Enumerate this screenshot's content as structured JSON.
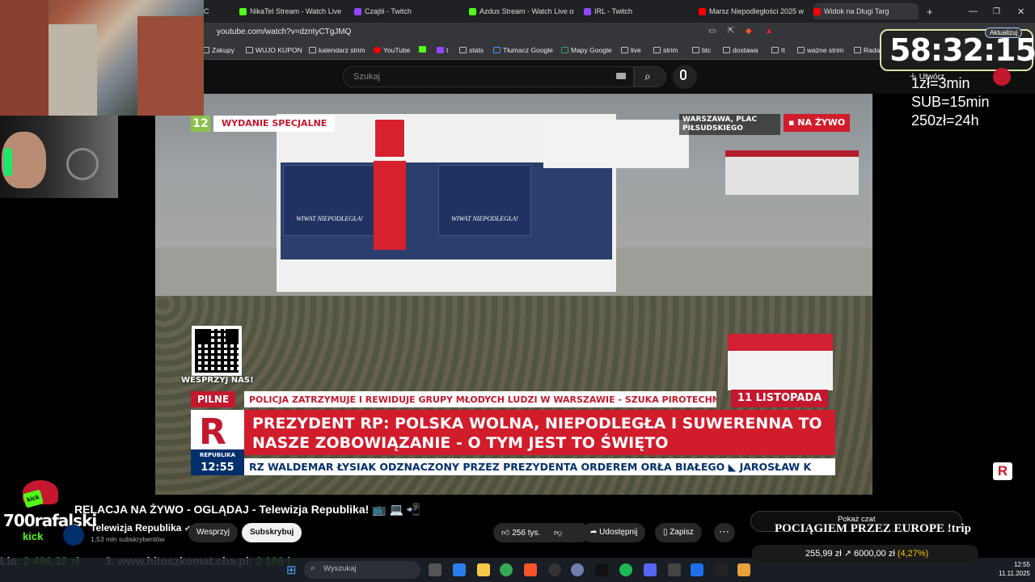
{
  "browser": {
    "tabs": [
      {
        "label": "C",
        "color": "#888888"
      },
      {
        "label": "NikaTel Stream - Watch Live",
        "color": "#53fc18"
      },
      {
        "label": "Czajtii - Twitch",
        "color": "#9146ff"
      },
      {
        "label": "Azdus Stream - Watch Live on",
        "color": "#53fc18"
      },
      {
        "label": "IRL - Twitch",
        "color": "#9146ff"
      },
      {
        "label": "Marsz Niepodległości 2025 w",
        "color": "#ff0000"
      },
      {
        "label": "Widok na Długi Targ",
        "color": "#ff0000"
      }
    ],
    "new_tab": "+",
    "url": "youtube.com/watch?v=dzntyCTgJMQ",
    "update_label": "Aktualizuj",
    "bookmarks": [
      "Zakupy",
      "WUJO KUPON",
      "kalendarz strim",
      "YouTube",
      "t",
      "stats",
      "Tłumacz Google",
      "Mapy Google",
      "live",
      "strim",
      "btc",
      "dostawa",
      "tt",
      "ważne strim",
      "Rada"
    ]
  },
  "youtube": {
    "search_placeholder": "Szukaj",
    "create_label": "Utwórz",
    "video_title": "RELACJA NA ŻYWO - OGLĄDAJ - Telewizja Republika! 📺 💻 📲",
    "channel_name": "Telewizja Republika",
    "subscribers": "1,53 mln subskrybentów",
    "support_label": "Wesprzyj",
    "subscribe_label": "Subskrybuj",
    "likes": "256 tys.",
    "share_label": "Udostępnij",
    "save_label": "Zapisz",
    "more_label": "⋯",
    "show_chat_label": "Pokaż czat"
  },
  "broadcast": {
    "channel_number": "12",
    "special_edition": "WYDANIE SPECJALNE",
    "location": "WARSZAWA, PLAC PIŁSUDSKIEGO",
    "live_label": "▪ NA ŻYWO",
    "banner_text": "WIWAT NIEPODLEGŁA!",
    "qr_caption": "WESPRZYJ NAS!",
    "date_label": "11 LISTOPADA",
    "urgent_label": "PILNE",
    "urgent_text": "POLICJA ZATRZYMUJE I REWIDUJE GRUPY MŁODYCH LUDZI W WARSZAWIE - SZUKA PIROTECHNIKI",
    "headline": "PREZYDENT RP: POLSKA WOLNA, NIEPODLEGŁA I SUWERENNA TO NASZE ZOBOWIĄZANIE - O TYM JEST TO ŚWIĘTO",
    "logo_letter": "R",
    "logo_name": "REPUBLIKA",
    "time": "12:55",
    "ticker": "RZ WALDEMAR ŁYSIAK ODZNACZONY PRZEZ PREZYDENTA ORDEREM ORŁA BIAŁEGO   ◣   JAROSŁAW K"
  },
  "stream_overlay": {
    "timer": "58:32:15",
    "rates": [
      "1zł=3min",
      "SUB=15min",
      "250zł=24h"
    ],
    "streamer_name": "700rafalski",
    "platform": "kick",
    "trip_text": "POCIĄGIEM PRZEZ EUROPE !trip",
    "donations": {
      "label": "Lia:",
      "amount": "2 496,32 zł",
      "goal_label": "3. www.hitoszkomat.cba.pl:",
      "goal_amount": "2 106 l"
    },
    "btc": {
      "price": "255,99 zł",
      "arrow": "↗",
      "target": "6000,00 zł",
      "pct": "(4,27%)"
    }
  },
  "taskbar": {
    "search_placeholder": "Wyszukaj",
    "time": "12:55",
    "date": "11.11.2025"
  }
}
